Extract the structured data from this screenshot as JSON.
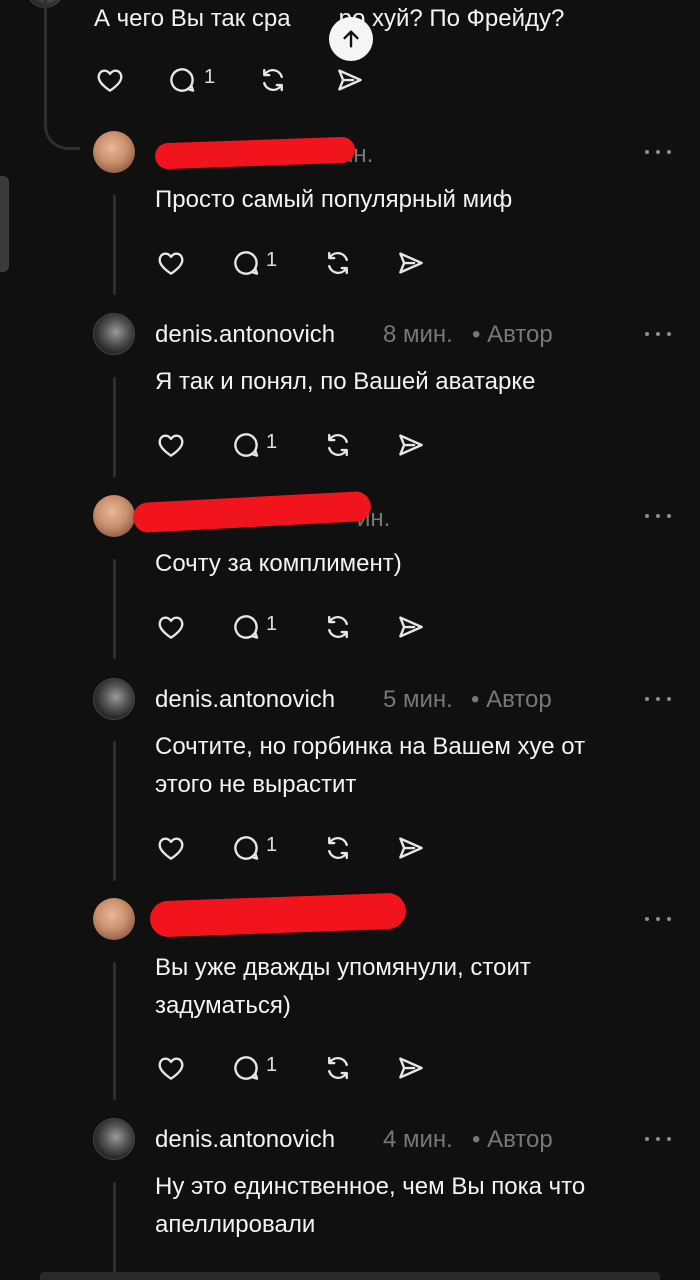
{
  "top_comment": {
    "text": "А чего Вы так сра  ро хуй? По Фрейду?",
    "reply_count": "1"
  },
  "scroll_to_top": {
    "icon": "arrow-up-icon"
  },
  "comments": [
    {
      "author": "",
      "time": "ин.",
      "badge": "",
      "text_lines": [
        "Просто самый популярный миф"
      ],
      "reply_count": "1"
    },
    {
      "author": "denis.antonovich",
      "time": "8 мин.",
      "badge": "• Автор",
      "text_lines": [
        "Я так и понял, по Вашей аватарке"
      ],
      "reply_count": "1"
    },
    {
      "author": "",
      "time": "ин.",
      "badge": "",
      "text_lines": [
        "Сочту за комплимент)"
      ],
      "reply_count": "1"
    },
    {
      "author": "denis.antonovich",
      "time": "5 мин.",
      "badge": "• Автор",
      "text_lines": [
        "Сочтите, но горбинка на Вашем хуе от",
        "этого не вырастит"
      ],
      "reply_count": "1"
    },
    {
      "author": "",
      "time": "",
      "badge": "",
      "text_lines": [
        "Вы уже дважды упомянули, стоит",
        "задуматься)"
      ],
      "reply_count": "1"
    },
    {
      "author": "denis.antonovich",
      "time": "4 мин.",
      "badge": "• Автор",
      "text_lines": [
        "Ну это единственное, чем Вы пока что",
        "апеллировали"
      ],
      "reply_count": ""
    }
  ],
  "icons": {
    "like": "heart-icon",
    "reply": "comment-icon",
    "repost": "repost-icon",
    "share": "send-icon",
    "more": "more-icon"
  }
}
